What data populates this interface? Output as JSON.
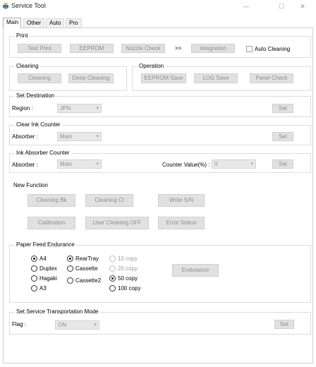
{
  "window": {
    "title": "Service Tool",
    "minimize": "—",
    "maximize": "☐",
    "close": "✕"
  },
  "tabs": [
    {
      "label": "Main",
      "active": true
    },
    {
      "label": "Other",
      "active": false
    },
    {
      "label": "Auto",
      "active": false
    },
    {
      "label": "Pro",
      "active": false
    }
  ],
  "print": {
    "title": "Print",
    "test_print": "Test Print",
    "eeprom": "EEPROM",
    "nozzle_check": "Nozzle Check",
    "arrow": ">>",
    "integration": "Integration",
    "auto_cleaning": {
      "label": "Auto Cleaning",
      "checked": false
    }
  },
  "cleaning": {
    "title": "Cleaning",
    "cleaning": "Cleaning",
    "deep_cleaning": "Deep Cleaning"
  },
  "operation": {
    "title": "Operation",
    "eeprom_save": "EEPROM Save",
    "log_save": "LOG Save",
    "panel_check": "Panel Check"
  },
  "set_destination": {
    "title": "Set Destination",
    "region_label": "Region :",
    "region_value": "JPN",
    "set": "Set"
  },
  "clear_ink_counter": {
    "title": "Clear Ink Counter",
    "absorber_label": "Absorber :",
    "absorber_value": "Main",
    "set": "Set"
  },
  "ink_absorber_counter": {
    "title": "Ink Absorber Counter",
    "absorber_label": "Absorber :",
    "absorber_value": "Main",
    "counter_label": "Counter Value(%) :",
    "counter_value": "0",
    "set": "Set"
  },
  "new_function": {
    "title": "New Function",
    "cleaning_bk": "Cleaning Bk",
    "cleaning_cl": "Cleaning Cl",
    "write_sn": "Write S/N",
    "calibration": "Calibration",
    "user_cleaning_off": "User Cleaning OFF",
    "error_status": "Error Status"
  },
  "paper_feed_endurance": {
    "title": "Paper Feed Endurance",
    "paper_size": [
      {
        "label": "A4",
        "selected": true
      },
      {
        "label": "Duplex",
        "selected": false
      },
      {
        "label": "Hagaki",
        "selected": false
      },
      {
        "label": "A3",
        "selected": false
      }
    ],
    "feed": [
      {
        "label": "RearTray",
        "selected": true
      },
      {
        "label": "Cassette",
        "selected": false
      },
      {
        "label": "Cassette2",
        "selected": false
      }
    ],
    "copies": [
      {
        "label": "10 copy",
        "selected": false,
        "enabled": false
      },
      {
        "label": "20 copy",
        "selected": false,
        "enabled": false
      },
      {
        "label": "50 copy",
        "selected": true,
        "enabled": true
      },
      {
        "label": "100 copy",
        "selected": false,
        "enabled": true
      }
    ],
    "endurance": "Endurance"
  },
  "transport_mode": {
    "title": "Set Service Transportation Mode",
    "flag_label": "Flag :",
    "flag_value": "ON",
    "set": "Set"
  },
  "icons": {
    "dropdown": "▾",
    "app": "printer-icon"
  }
}
